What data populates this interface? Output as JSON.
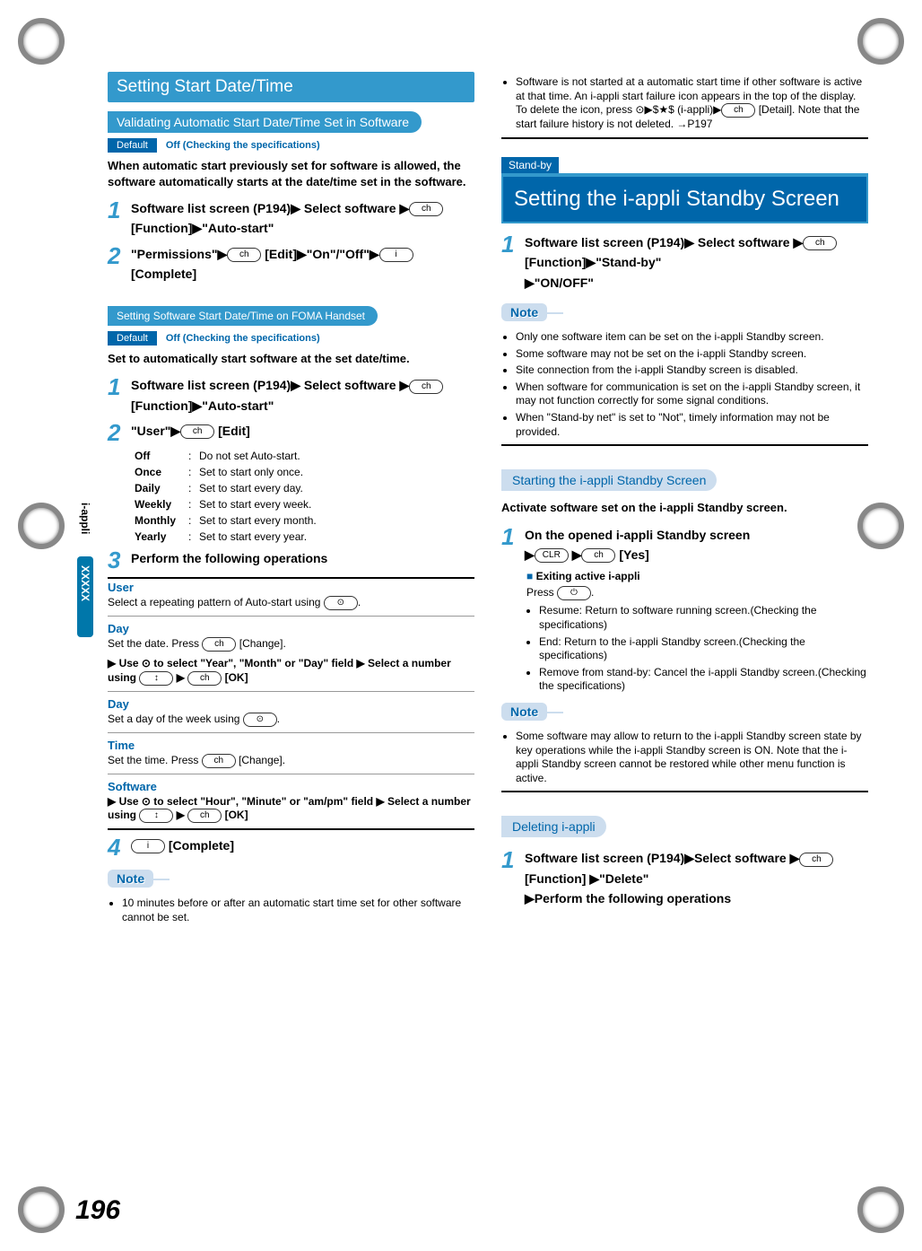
{
  "page_number": "196",
  "side_tab": "i-appli",
  "side_xxxxx": "XXXXX",
  "left": {
    "section_bar": "Setting Start Date/Time",
    "sub1": {
      "title": "Validating Automatic Start Date/Time Set in Software",
      "default_label": "Default",
      "default_value": "Off (Checking the specifications)",
      "intro": "When automatic start previously set for software is allowed, the software automatically starts at the date/time set in the software.",
      "step1_pre": "Software list screen (P194)",
      "step1_mid": " Select software ",
      "step1_key": "ch",
      "step1_func": " [Function]",
      "step1_end": "\"Auto-start\"",
      "step2_a": "\"Permissions\"",
      "step2_key1": "ch",
      "step2_edit": " [Edit]",
      "step2_b": "\"On\"/\"Off\"",
      "step2_key2": "i",
      "step2_complete": " [Complete]"
    },
    "sub2": {
      "title": "Setting Software Start Date/Time on FOMA Handset",
      "default_label": "Default",
      "default_value": "Off (Checking the specifications)",
      "intro": "Set to automatically start software at the set date/time.",
      "step1_pre": "Software list screen (P194)",
      "step1_mid": " Select software ",
      "step1_key": "ch",
      "step1_func": " [Function]",
      "step1_end": "\"Auto-start\"",
      "step2_a": "\"User\"",
      "step2_key": "ch",
      "step2_edit": " [Edit]",
      "options": [
        {
          "name": "Off",
          "desc": "Do not set Auto-start."
        },
        {
          "name": "Once",
          "desc": "Set to start only once."
        },
        {
          "name": "Daily",
          "desc": "Set to start every day."
        },
        {
          "name": "Weekly",
          "desc": "Set to start every week."
        },
        {
          "name": "Monthly",
          "desc": "Set to start every month."
        },
        {
          "name": "Yearly",
          "desc": "Set to start every year."
        }
      ],
      "step3": "Perform the following operations",
      "user_label": "User",
      "user_desc": "Select a repeating pattern of Auto-start using ",
      "day1_label": "Day",
      "day1_desc": "Set the date. Press ",
      "day1_change": " [Change].",
      "day1_use": "Use ⊙ to select \"Year\", \"Month\" or \"Day\" field ▶ Select a number using ",
      "day1_ok": " [OK]",
      "day2_label": "Day",
      "day2_desc": "Set a day of the week using ",
      "time_label": "Time",
      "time_desc": "Set the time. Press ",
      "time_change": " [Change].",
      "software_label": "Software",
      "software_use": "Use ⊙ to select \"Hour\", \"Minute\" or \"am/pm\" field ▶ Select a number using ",
      "software_ok": " [OK]",
      "step4_key": "i",
      "step4_complete": " [Complete]",
      "note_label": "Note",
      "note_item": "10 minutes before or after an automatic start time set for other software cannot be set."
    }
  },
  "right": {
    "top_note": "Software is not started at a automatic start time if other software is active at that time. An i-appli start failure icon appears in the top of the display. To delete the icon, press ⊙▶$★$ (i-appli)▶",
    "top_note_key": "ch",
    "top_note_detail": " [Detail]. Note that the start failure history is not deleted. →P197",
    "standby_tag": "Stand-by",
    "major_heading": "Setting the i-appli Standby Screen",
    "step1_pre": "Software list screen (P194)",
    "step1_mid": " Select software ",
    "step1_key": "ch",
    "step1_func": " [Function]",
    "step1_end": "\"Stand-by\"",
    "step1_onoff": "\"ON/OFF\"",
    "note1_label": "Note",
    "note1_items": [
      "Only one software item can be set on the i-appli Standby screen.",
      "Some software may not be set on the i-appli Standby screen.",
      "Site connection from the i-appli Standby screen is disabled.",
      "When software for communication is set on the i-appli Standby screen, it may not function correctly for some signal conditions.",
      "When \"Stand-by net\" is set to \"Not\", timely information may not be provided."
    ],
    "starting_pill": "Starting the i-appli Standby Screen",
    "starting_intro": "Activate software set on the i-appli Standby screen.",
    "start_step1": "On the opened i-appli Standby screen",
    "start_step1_key1": "CLR",
    "start_step1_key2": "ch",
    "start_step1_yes": " [Yes]",
    "exiting_label": "Exiting active i-appli",
    "exiting_press": "Press ",
    "exiting_key": "⏻",
    "exiting_items": [
      "Resume: Return to software running screen.(Checking the specifications)",
      "End: Return to the i-appli Standby screen.(Checking the specifications)",
      "Remove from stand-by: Cancel the i-appli Standby screen.(Checking the specifications)"
    ],
    "note2_label": "Note",
    "note2_item": "Some software may allow to return to the i-appli Standby screen state by key operations while the i-appli Standby screen is ON. Note that the i-appli Standby screen cannot be restored while other menu function is active.",
    "deleting_pill": "Deleting i-appli",
    "del_step1_pre": "Software list screen (P194)",
    "del_step1_sel": "Select software ",
    "del_step1_key": "ch",
    "del_step1_func": " [Function] ",
    "del_step1_end": "\"Delete\"",
    "del_step1_perform": "Perform the following operations"
  }
}
